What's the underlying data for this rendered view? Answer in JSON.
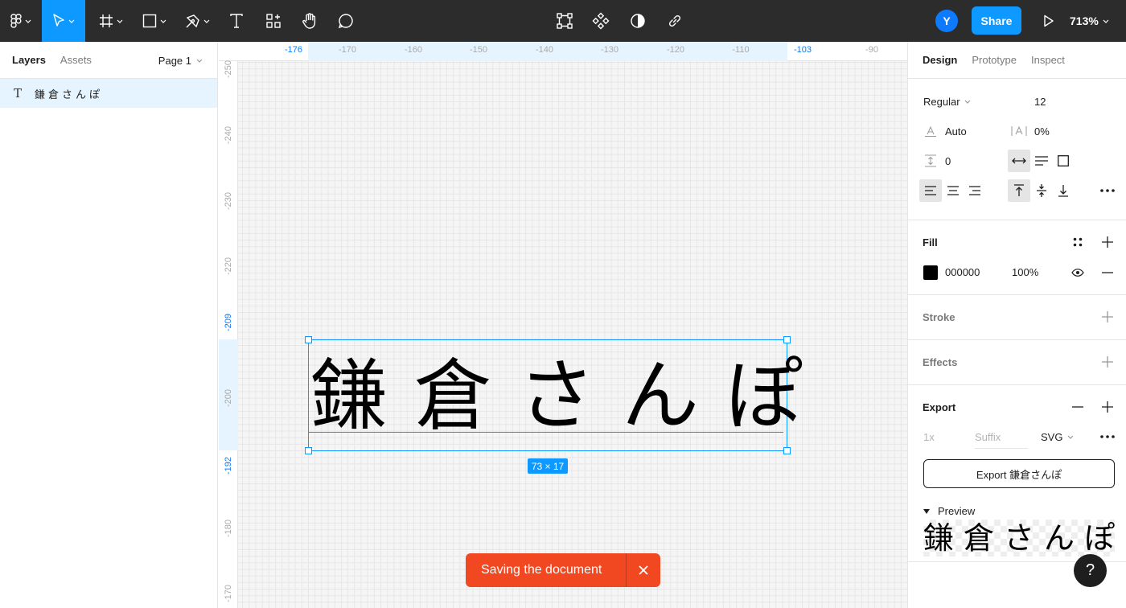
{
  "toolbar": {
    "share_label": "Share",
    "avatar_initial": "Y",
    "zoom": "713%"
  },
  "left_panel": {
    "tabs": [
      {
        "label": "Layers"
      },
      {
        "label": "Assets"
      }
    ],
    "page_selector": "Page 1",
    "layers": [
      {
        "name": "鎌倉さんぽ",
        "type": "text"
      }
    ]
  },
  "canvas": {
    "ruler_top": [
      "-176",
      "-170",
      "-160",
      "-150",
      "-140",
      "-130",
      "-120",
      "-110",
      "-103",
      "-90"
    ],
    "ruler_left": [
      "-250",
      "-240",
      "-230",
      "-220",
      "-209",
      "-200",
      "-192",
      "-180",
      "-170"
    ],
    "text_content": "鎌倉さんぽ",
    "size_badge": "73 × 17"
  },
  "toast": {
    "message": "Saving the document"
  },
  "right_panel": {
    "tabs": [
      {
        "label": "Design"
      },
      {
        "label": "Prototype"
      },
      {
        "label": "Inspect"
      }
    ],
    "text": {
      "font_style": "Regular",
      "font_size": "12",
      "line_height": "Auto",
      "letter_spacing": "0%",
      "paragraph_spacing": "0"
    },
    "fill": {
      "title": "Fill",
      "hex": "000000",
      "opacity": "100%",
      "color": "#000000"
    },
    "stroke": {
      "title": "Stroke"
    },
    "effects": {
      "title": "Effects"
    },
    "export": {
      "title": "Export",
      "scale": "1x",
      "suffix_placeholder": "Suffix",
      "format": "SVG",
      "button_label": "Export 鎌倉さんぽ",
      "preview_label": "Preview",
      "preview_text": "鎌倉さんぽ"
    }
  },
  "help_label": "?",
  "colors": {
    "accent": "#0d99ff",
    "toolbar_bg": "#2c2c2c",
    "toast": "#f24822"
  }
}
